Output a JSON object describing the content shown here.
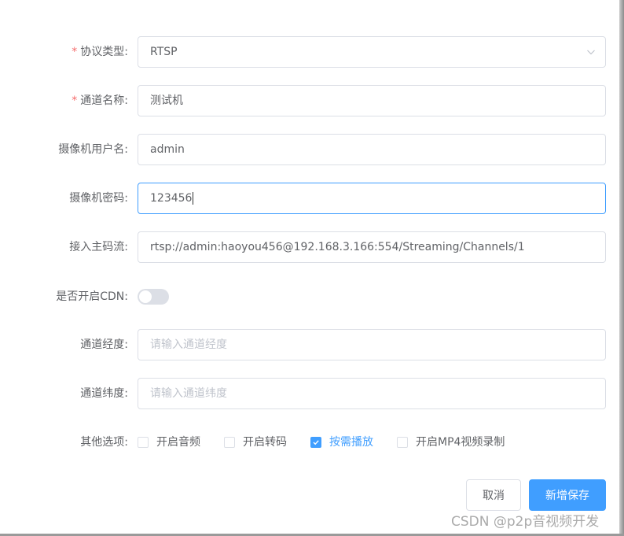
{
  "form": {
    "protocol": {
      "required": true,
      "label": "协议类型:",
      "value": "RTSP"
    },
    "channel_name": {
      "required": true,
      "label": "通道名称:",
      "value": "测试机"
    },
    "camera_user": {
      "label": "摄像机用户名:",
      "value": "admin"
    },
    "camera_password": {
      "label": "摄像机密码:",
      "value": "123456"
    },
    "main_stream": {
      "label": "接入主码流:",
      "value": "rtsp://admin:haoyou456@192.168.3.166:554/Streaming/Channels/1"
    },
    "cdn": {
      "label": "是否开启CDN:",
      "enabled": false
    },
    "longitude": {
      "label": "通道经度:",
      "placeholder": "请输入通道经度"
    },
    "latitude": {
      "label": "通道纬度:",
      "placeholder": "请输入通道纬度"
    },
    "options": {
      "label": "其他选项:",
      "items": [
        {
          "label": "开启音频",
          "checked": false
        },
        {
          "label": "开启转码",
          "checked": false
        },
        {
          "label": "按需播放",
          "checked": true
        },
        {
          "label": "开启MP4视频录制",
          "checked": false
        }
      ]
    }
  },
  "buttons": {
    "cancel": "取消",
    "save": "新增保存"
  },
  "colors": {
    "accent": "#409eff",
    "required": "#f56c6c",
    "border": "#dcdfe6"
  },
  "watermark": "CSDN @p2p音视频开发"
}
